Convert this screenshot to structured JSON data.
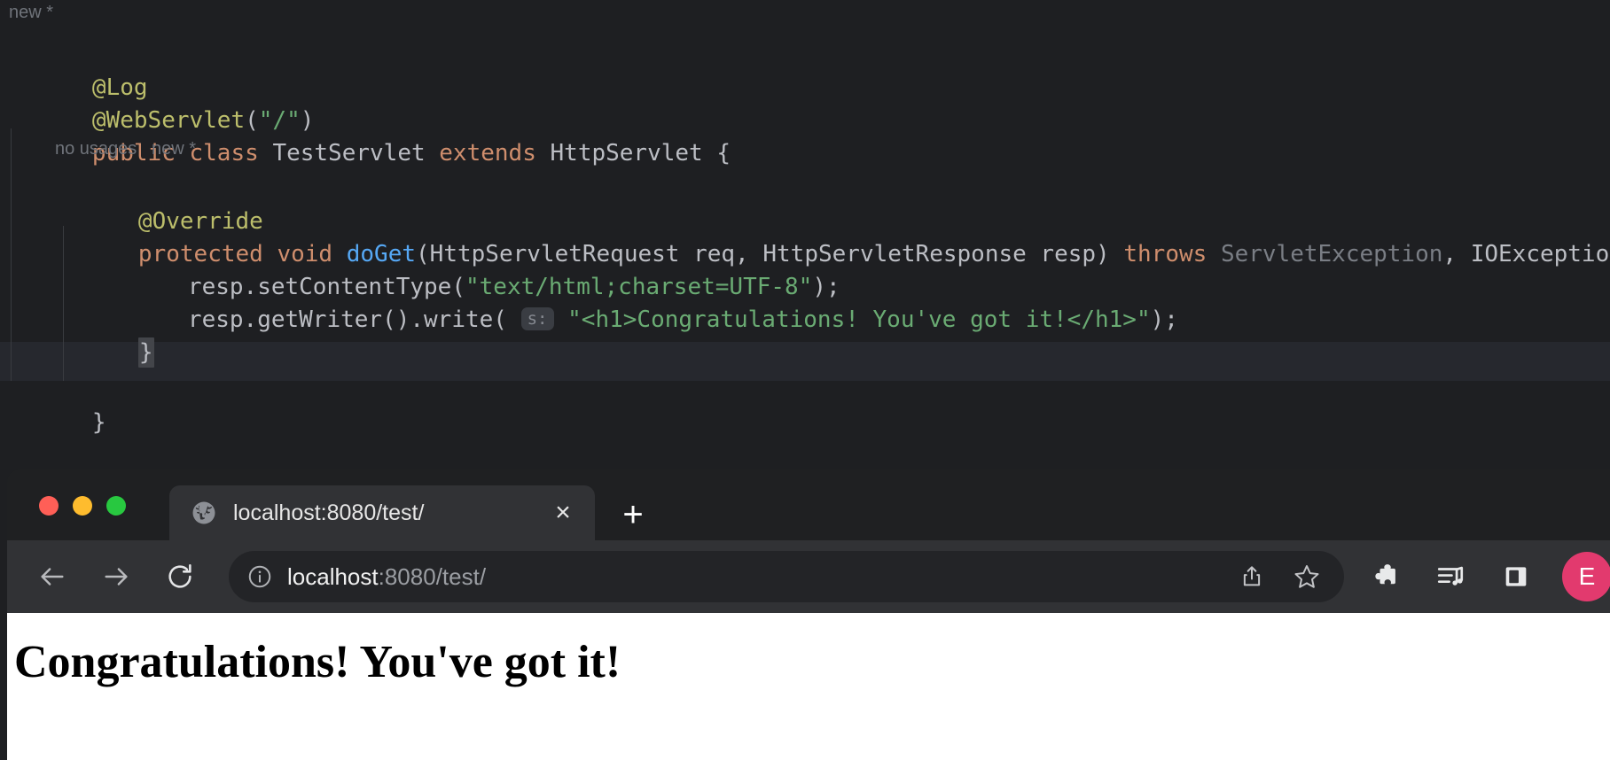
{
  "ide": {
    "gutter_hints": {
      "class_hint": "new *",
      "method_hint": "no usages   new *"
    },
    "code": {
      "annotation_log": "@Log",
      "annotation_webservlet_name": "@WebServlet",
      "annotation_webservlet_open": "(",
      "annotation_webservlet_arg": "\"/\"",
      "annotation_webservlet_close": ")",
      "class_kw_public": "public",
      "class_kw_class": "class",
      "class_name": "TestServlet",
      "class_kw_extends": "extends",
      "class_super": "HttpServlet",
      "class_brace": "{",
      "annotation_override": "@Override",
      "method_kw_protected": "protected",
      "method_kw_void": "void",
      "method_name": "doGet",
      "method_params": "(HttpServletRequest req, HttpServletResponse resp)",
      "method_kw_throws": "throws",
      "method_throws_1": "ServletException",
      "method_throws_comma": ",",
      "method_throws_2": "IOException",
      "method_brace": "{",
      "stmt1_call": "resp.setContentType(",
      "stmt1_arg": "\"text/html;charset=UTF-8\"",
      "stmt1_end": ");",
      "stmt2_call": "resp.getWriter().write(",
      "stmt2_param_hint": "s:",
      "stmt2_arg": "\"<h1>Congratulations! You've got it!</h1>\"",
      "stmt2_end": ");",
      "method_close_brace": "}",
      "class_close_brace": "}"
    },
    "colors": {
      "background": "#1e1f22",
      "current_line": "#26282e",
      "keyword": "#cf8e6d",
      "annotation": "#bcbe6b",
      "string": "#6aab73",
      "method": "#56a8f5",
      "identifier": "#bcbec4",
      "muted": "#7a7e85",
      "brace_match": "#43454a"
    }
  },
  "browser": {
    "window_controls": {
      "close_color": "#ff5f57",
      "minimize_color": "#febc2e",
      "maximize_color": "#28c840"
    },
    "tab": {
      "favicon": "globe-icon",
      "title": "localhost:8080/test/",
      "close_label": "×"
    },
    "new_tab_label": "+",
    "toolbar": {
      "back_label": "back-arrow-icon",
      "forward_label": "forward-arrow-icon",
      "reload_label": "reload-icon",
      "site_info_label": "info-circle-icon",
      "url_host": "localhost",
      "url_rest": ":8080/test/",
      "url_full": "localhost:8080/test/",
      "share_label": "share-icon",
      "bookmark_label": "star-icon",
      "extensions_label": "puzzle-piece-icon",
      "media_label": "media-list-icon",
      "sidebar_label": "side-panel-icon",
      "profile_initial": "E",
      "profile_color": "#e23a6e"
    },
    "page": {
      "heading": "Congratulations! You've got it!"
    }
  }
}
